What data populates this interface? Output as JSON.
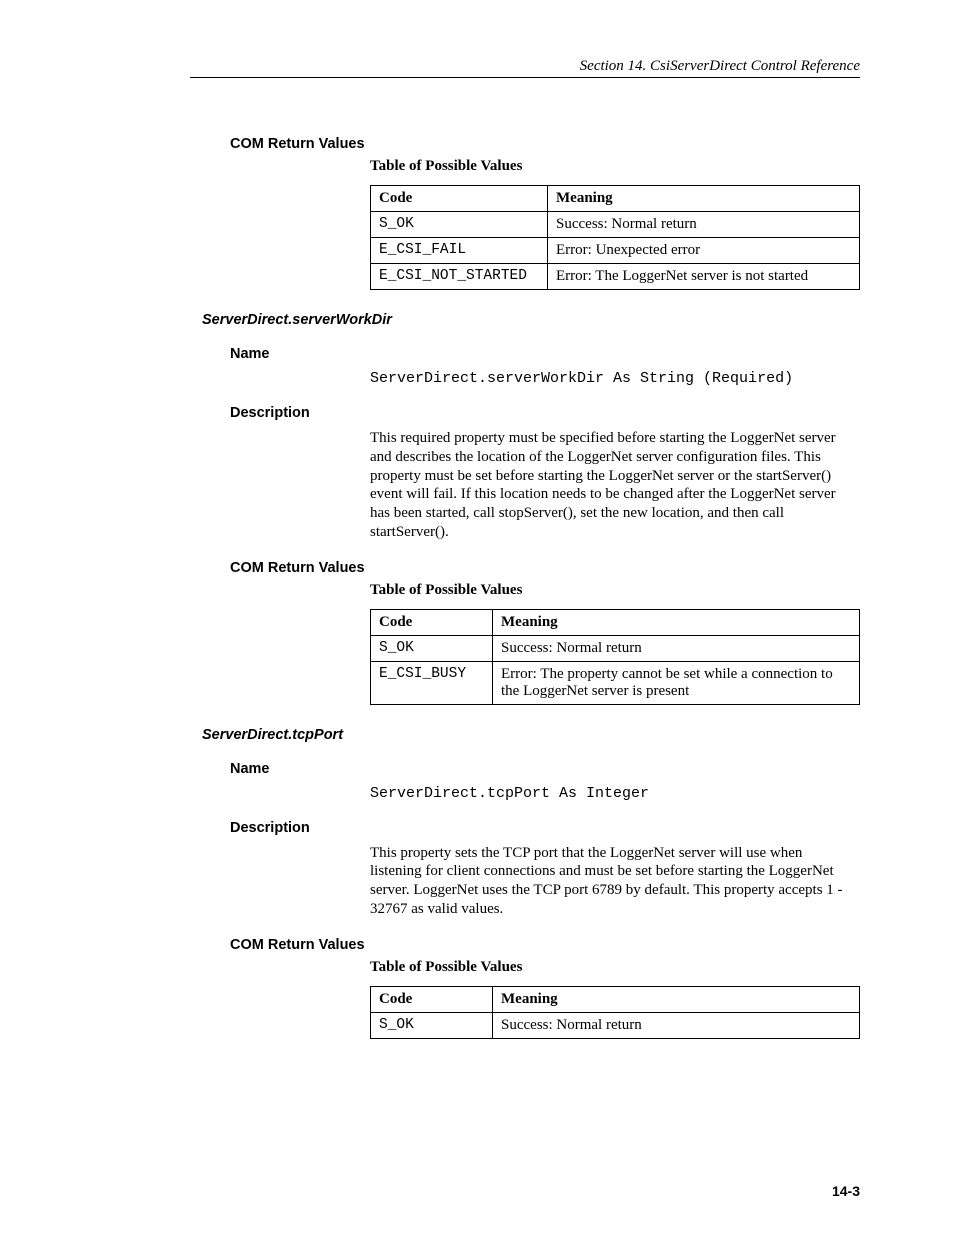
{
  "header": "Section 14.  CsiServerDirect Control Reference",
  "pageNumber": "14-3",
  "sections": [
    {
      "heading1": "COM Return Values",
      "tableCaption": "Table of Possible Values",
      "table": {
        "headers": [
          "Code",
          "Meaning"
        ],
        "rows": [
          [
            "S_OK",
            "Success: Normal return"
          ],
          [
            "E_CSI_FAIL",
            "Error: Unexpected error"
          ],
          [
            "E_CSI_NOT_STARTED",
            "Error: The LoggerNet server is not started"
          ]
        ]
      }
    },
    {
      "heading2": "ServerDirect.serverWorkDir",
      "nameLabel": "Name",
      "nameCode": "ServerDirect.serverWorkDir As String (Required)",
      "descLabel": "Description",
      "descText": "This required property must be specified before starting the LoggerNet server and describes the location of the LoggerNet server configuration files.  This property must be set before starting the LoggerNet server or the startServer() event will fail.  If this location needs to be changed after the LoggerNet server has been started, call stopServer(), set the new location, and then call startServer().",
      "heading1": "COM Return Values",
      "tableCaption": "Table of Possible Values",
      "table": {
        "headers": [
          "Code",
          "Meaning"
        ],
        "rows": [
          [
            "S_OK",
            "Success: Normal return"
          ],
          [
            "E_CSI_BUSY",
            "Error: The property cannot be set while a connection to the LoggerNet server is present"
          ]
        ]
      }
    },
    {
      "heading2": "ServerDirect.tcpPort",
      "nameLabel": "Name",
      "nameCode": "ServerDirect.tcpPort As Integer",
      "descLabel": "Description",
      "descText": "This property sets the TCP port that the LoggerNet server will use when listening for client connections and must be set before starting the LoggerNet server.  LoggerNet uses the TCP port 6789 by default.  This property accepts 1 - 32767 as valid values.",
      "heading1": "COM Return Values",
      "tableCaption": "Table of Possible Values",
      "table": {
        "headers": [
          "Code",
          "Meaning"
        ],
        "rows": [
          [
            "S_OK",
            "Success: Normal return"
          ]
        ]
      }
    }
  ]
}
